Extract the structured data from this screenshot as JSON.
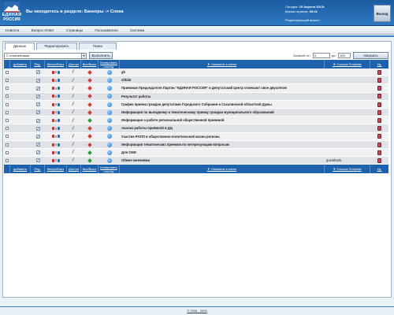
{
  "header": {
    "logo": {
      "line1": "ЕДИНАЯ",
      "line2": "РОССИЯ",
      "line3": ""
    },
    "location_text": "Вы находитесь в разделе: Баннеры -> Слева",
    "sysinfo": {
      "today_label": "Сегодня:",
      "today_value": "19 Апреля 2012г.",
      "server_time_label": "Время сервера:",
      "server_time_value": "09:41",
      "editor_label": "Редактирующий вышел"
    },
    "exit_label": "Выход"
  },
  "menu": {
    "items": [
      "Новости",
      "Вопрос-Ответ",
      "Страницы",
      "Пользователи",
      "Система"
    ]
  },
  "tabs": [
    "Данные",
    "Редактировать",
    "Поиск"
  ],
  "filter": {
    "select_value": "С отмеченными",
    "execute_label": "Выполнить",
    "records_from_label": "Записей от:",
    "records_from_value": "0",
    "records_to_label": "до:",
    "records_to_value": "100",
    "show_label": "показать"
  },
  "table": {
    "columns": {
      "add": "добавить",
      "edit": "Ред.",
      "updown": "Вверх/Вниз",
      "access": "Доступ",
      "onoff": "Вкл/Выкл",
      "copy": "Копировать ссылку",
      "title": "▼ Название в меню",
      "link": "▼ Ссылка Template",
      "del": "Уд."
    },
    "rows": [
      {
        "title": "gh",
        "link": "",
        "on": "red"
      },
      {
        "title": "shfabr",
        "link": "",
        "on": "red"
      },
      {
        "title": "Приемная Председателя Партии \"ЕДИНАЯ РОССИЯ\" и Депутатский Центр отмечают свое двухлетие",
        "link": "",
        "on": "red"
      },
      {
        "title": "Результат работы",
        "link": "",
        "on": "red"
      },
      {
        "title": "График приема граждан депутатами Городского Собрания и Сахалинской областной Думы",
        "link": "",
        "on": "red"
      },
      {
        "title": "Информация по выездному и тематическому приему граждан муниципального образований",
        "link": "",
        "on": "red"
      },
      {
        "title": "Информация о работе региональной общественной приемной",
        "link": "",
        "on": "green"
      },
      {
        "title": "Анализ работы приёмной в ДЦ",
        "link": "",
        "on": "red"
      },
      {
        "title": "Участие РОПП в общественно-политической жизни региона",
        "link": "",
        "on": "red"
      },
      {
        "title": "Информация тематических приемов по интересующим вопросам",
        "link": "",
        "on": "red"
      },
      {
        "title": "Для СМИ",
        "link": "",
        "on": "green"
      },
      {
        "title": "Обмен мнениями",
        "link": "guestbook",
        "on": "green"
      }
    ]
  },
  "footer": "© 2006 - 2009"
}
